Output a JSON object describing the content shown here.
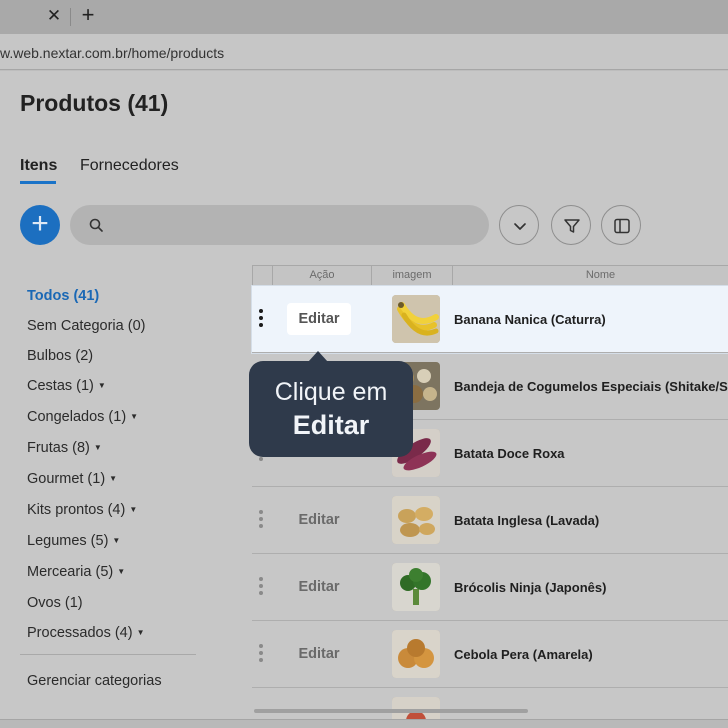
{
  "browser": {
    "url": "w.web.nextar.com.br/home/products",
    "close_glyph": "✕",
    "newtab_glyph": "+"
  },
  "page": {
    "title": "Produtos (41)",
    "tabs": [
      {
        "label": "Itens",
        "active": true
      },
      {
        "label": "Fornecedores",
        "active": false
      }
    ],
    "add_glyph": "+",
    "search": {
      "placeholder": "",
      "icon": "search-icon"
    },
    "toolbar_icons": [
      "chevron-down-icon",
      "filter-icon",
      "sidebar-toggle-icon"
    ]
  },
  "sidebar": {
    "categories": [
      {
        "label": "Todos (41)",
        "active": true,
        "expandable": false
      },
      {
        "label": "Sem Categoria (0)",
        "active": false,
        "expandable": false
      },
      {
        "label": "Bulbos (2)",
        "active": false,
        "expandable": false
      },
      {
        "label": "Cestas (1)",
        "active": false,
        "expandable": true
      },
      {
        "label": "Congelados (1)",
        "active": false,
        "expandable": true
      },
      {
        "label": "Frutas (8)",
        "active": false,
        "expandable": true
      },
      {
        "label": "Gourmet (1)",
        "active": false,
        "expandable": true
      },
      {
        "label": "Kits prontos (4)",
        "active": false,
        "expandable": true
      },
      {
        "label": "Legumes (5)",
        "active": false,
        "expandable": true
      },
      {
        "label": "Mercearia (5)",
        "active": false,
        "expandable": true
      },
      {
        "label": "Ovos (1)",
        "active": false,
        "expandable": false
      },
      {
        "label": "Processados (4)",
        "active": false,
        "expandable": true
      }
    ],
    "manage_label": "Gerenciar categorias",
    "caret_glyph": "▼"
  },
  "table": {
    "columns": [
      "Ação",
      "imagem",
      "Nome"
    ],
    "edit_label": "Editar",
    "rows": [
      {
        "name": "Banana Nanica (Caturra)",
        "highlighted": true
      },
      {
        "name": "Bandeja de Cogumelos Especiais (Shitake/S",
        "highlighted": false
      },
      {
        "name": "Batata Doce Roxa",
        "highlighted": false
      },
      {
        "name": "Batata Inglesa (Lavada)",
        "highlighted": false
      },
      {
        "name": "Brócolis Ninja (Japonês)",
        "highlighted": false
      },
      {
        "name": "Cebola Pera (Amarela)",
        "highlighted": false
      }
    ]
  },
  "tooltip": {
    "line1": "Clique em",
    "line2": "Editar"
  },
  "colors": {
    "accent": "#1c6fc0",
    "tooltip_bg": "#2f3a4b",
    "highlight_row": "#eef4fb"
  }
}
